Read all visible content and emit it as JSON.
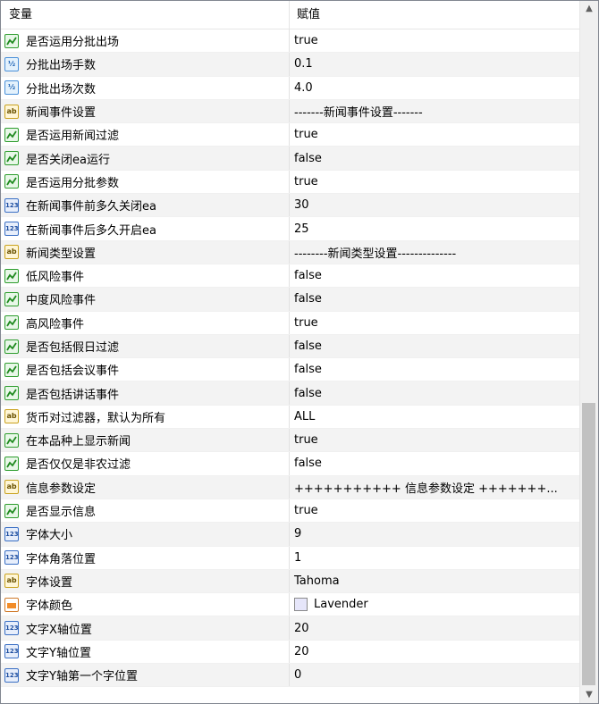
{
  "header": {
    "col_name": "变量",
    "col_value": "赋值"
  },
  "rows": [
    {
      "icon": "bool-icon",
      "name": "是否运用分批出场",
      "value": "true"
    },
    {
      "icon": "double-icon",
      "name": "分批出场手数",
      "value": "0.1"
    },
    {
      "icon": "double-icon",
      "name": "分批出场次数",
      "value": "4.0"
    },
    {
      "icon": "string-icon",
      "name": "新闻事件设置",
      "value": "-------新闻事件设置-------"
    },
    {
      "icon": "bool-icon",
      "name": "是否运用新闻过滤",
      "value": "true"
    },
    {
      "icon": "bool-icon",
      "name": "是否关闭ea运行",
      "value": "false"
    },
    {
      "icon": "bool-icon",
      "name": "是否运用分批参数",
      "value": "true"
    },
    {
      "icon": "int-icon",
      "name": "在新闻事件前多久关闭ea",
      "value": "30"
    },
    {
      "icon": "int-icon",
      "name": "在新闻事件后多久开启ea",
      "value": "25"
    },
    {
      "icon": "string-icon",
      "name": "新闻类型设置",
      "value": "--------新闻类型设置--------------"
    },
    {
      "icon": "bool-icon",
      "name": "低风险事件",
      "value": "false"
    },
    {
      "icon": "bool-icon",
      "name": "中度风险事件",
      "value": "false"
    },
    {
      "icon": "bool-icon",
      "name": "高风险事件",
      "value": "true"
    },
    {
      "icon": "bool-icon",
      "name": "是否包括假日过滤",
      "value": "false"
    },
    {
      "icon": "bool-icon",
      "name": "是否包括会议事件",
      "value": "false"
    },
    {
      "icon": "bool-icon",
      "name": "是否包括讲话事件",
      "value": "false"
    },
    {
      "icon": "string-icon",
      "name": "货币对过滤器，默认为所有",
      "value": "ALL"
    },
    {
      "icon": "bool-icon",
      "name": "在本品种上显示新闻",
      "value": "true"
    },
    {
      "icon": "bool-icon",
      "name": "是否仅仅是非农过滤",
      "value": "false"
    },
    {
      "icon": "string-icon",
      "name": "信息参数设定",
      "value": "+++++++++++ 信息参数设定 +++++++..."
    },
    {
      "icon": "bool-icon",
      "name": "是否显示信息",
      "value": "true"
    },
    {
      "icon": "int-icon",
      "name": "字体大小",
      "value": "9"
    },
    {
      "icon": "int-icon",
      "name": "字体角落位置",
      "value": "1"
    },
    {
      "icon": "string-icon",
      "name": "字体设置",
      "value": "Tahoma"
    },
    {
      "icon": "color-icon",
      "name": "字体颜色",
      "value": "Lavender",
      "swatch": "#e6e6fa"
    },
    {
      "icon": "int-icon",
      "name": "文字X轴位置",
      "value": "20"
    },
    {
      "icon": "int-icon",
      "name": "文字Y轴位置",
      "value": "20"
    },
    {
      "icon": "int-icon",
      "name": "文字Y轴第一个字位置",
      "value": "0"
    }
  ],
  "icon_glyphs": {
    "double": "½",
    "int": "123",
    "string": "ab"
  },
  "scrollbar": {
    "up_arrow": "▲",
    "down_arrow": "▼"
  }
}
